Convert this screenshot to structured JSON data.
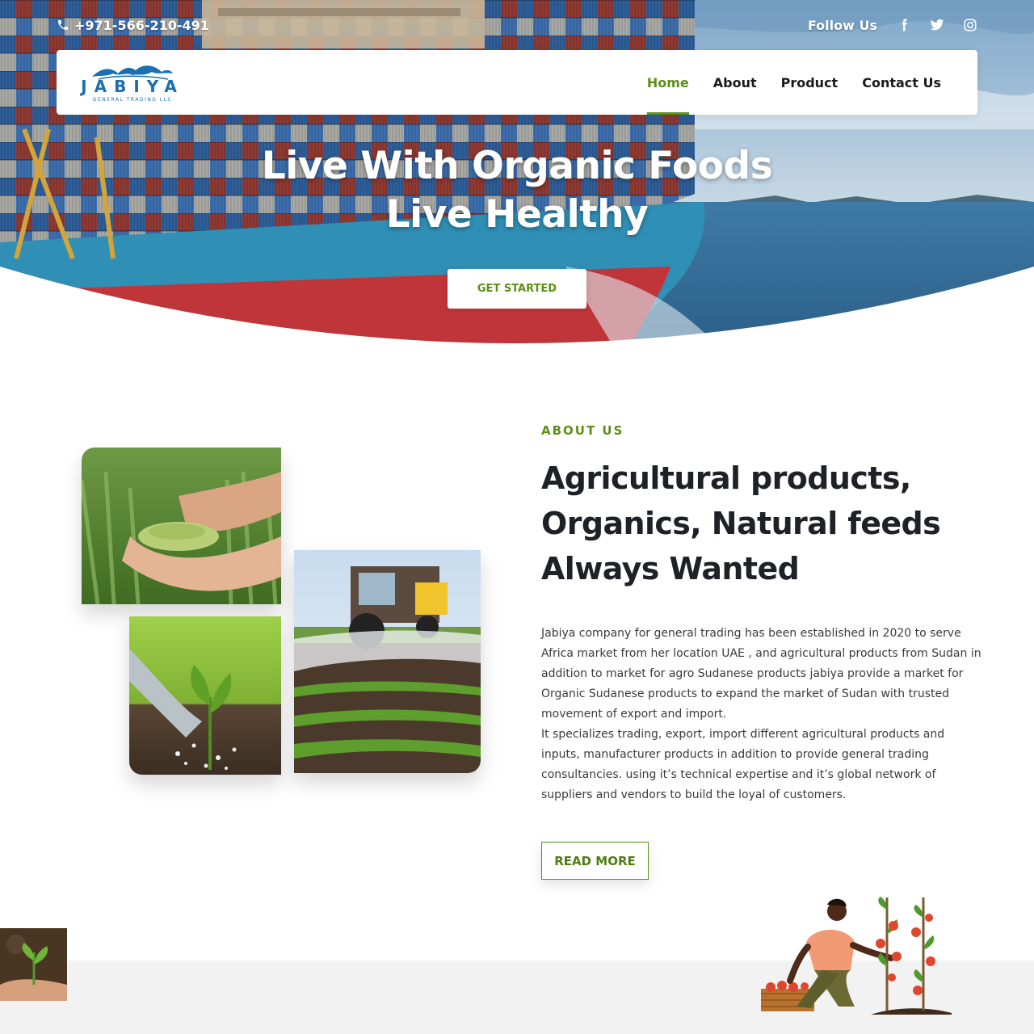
{
  "topbar": {
    "phone": "+971-566-210-491",
    "follow_label": "Follow Us",
    "social": [
      "facebook-icon",
      "twitter-icon",
      "instagram-icon"
    ]
  },
  "logo": {
    "name": "JABIYA",
    "subtitle": "GENERAL TRADING LLC"
  },
  "nav": {
    "items": [
      {
        "label": "Home",
        "active": true
      },
      {
        "label": "About",
        "active": false
      },
      {
        "label": "Product",
        "active": false
      },
      {
        "label": "Contact Us",
        "active": false
      }
    ]
  },
  "hero": {
    "title_line1": "Live With Organic Foods",
    "title_line2": "Live Healthy",
    "button": "GET STARTED"
  },
  "about": {
    "eyebrow": "ABOUT US",
    "title_line1": "Agricultural products,",
    "title_line2": "Organics, Natural feeds",
    "title_line3": "Always Wanted",
    "paragraph1": "Jabiya company for general trading has been established in 2020 to serve Africa market from her location UAE , and agricultural products from Sudan in addition to market for agro Sudanese products jabiya provide a market for Organic Sudanese products to expand the market of Sudan with trusted movement of export and import.",
    "paragraph2": "It specializes trading, export, import different agricultural products and inputs, manufacturer products in addition to provide general trading consultancies. using it’s technical expertise and it’s global network of suppliers and vendors to build the loyal of customers.",
    "button": "READ MORE"
  },
  "colors": {
    "accent": "#5c8f18",
    "logo_blue": "#1b6fb0",
    "text_dark": "#1f2126",
    "strip_gray": "#f2f2f2"
  }
}
